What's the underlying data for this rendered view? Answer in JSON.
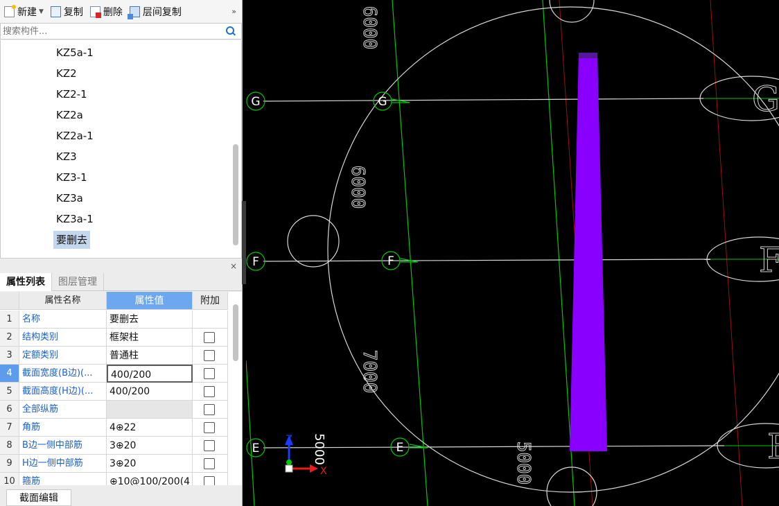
{
  "toolbar": {
    "new_label": "新建",
    "copy_label": "复制",
    "delete_label": "删除",
    "floor_copy_label": "层间复制",
    "more_label": "»"
  },
  "search": {
    "placeholder": "搜索构件..."
  },
  "tree": {
    "items": [
      "KZ5a-1",
      "KZ2",
      "KZ2-1",
      "KZ2a",
      "KZ2a-1",
      "KZ3",
      "KZ3-1",
      "KZ3a",
      "KZ3a-1",
      "要删去"
    ],
    "selected_index": 9
  },
  "panel": {
    "close_label": "×"
  },
  "tabs": [
    {
      "label": "属性列表",
      "active": true
    },
    {
      "label": "图层管理",
      "active": false
    }
  ],
  "property_table": {
    "headers": {
      "name": "属性名称",
      "value": "属性值",
      "extra": "附加"
    },
    "rows": [
      {
        "idx": "1",
        "name": "名称",
        "value": "要删去",
        "has_checkbox": false
      },
      {
        "idx": "2",
        "name": "结构类别",
        "value": "框架柱",
        "has_checkbox": true
      },
      {
        "idx": "3",
        "name": "定额类别",
        "value": "普通柱",
        "has_checkbox": true
      },
      {
        "idx": "4",
        "name": "截面宽度(B边)(...",
        "value": "400/200",
        "has_checkbox": true
      },
      {
        "idx": "5",
        "name": "截面高度(H边)(...",
        "value": "400/200",
        "has_checkbox": true
      },
      {
        "idx": "6",
        "name": "全部纵筋",
        "value": "",
        "has_checkbox": true
      },
      {
        "idx": "7",
        "name": "角筋",
        "value": "4⊕22",
        "has_checkbox": true
      },
      {
        "idx": "8",
        "name": "B边一侧中部筋",
        "value": "3⊕20",
        "has_checkbox": true
      },
      {
        "idx": "9",
        "name": "H边一侧中部筋",
        "value": "3⊕20",
        "has_checkbox": true
      },
      {
        "idx": "10",
        "name": "箍筋",
        "value": "⊕10@100/200(4",
        "has_checkbox": true
      }
    ],
    "selected_index": 3
  },
  "footer": {
    "section_edit_label": "截面编辑"
  },
  "canvas": {
    "axis_labels": [
      "G",
      "G",
      "F",
      "F",
      "E",
      "E"
    ],
    "large_labels": [
      "G",
      "F",
      "E"
    ],
    "dimensions": [
      "6000",
      "6000",
      "7000",
      "5000",
      "5000"
    ],
    "axis_indicator": {
      "z": "Z",
      "x": "X"
    },
    "colors": {
      "column": "#8a00ff",
      "grid": "#00c800",
      "line": "#d8d8d8",
      "red_line": "#9b1010"
    }
  }
}
